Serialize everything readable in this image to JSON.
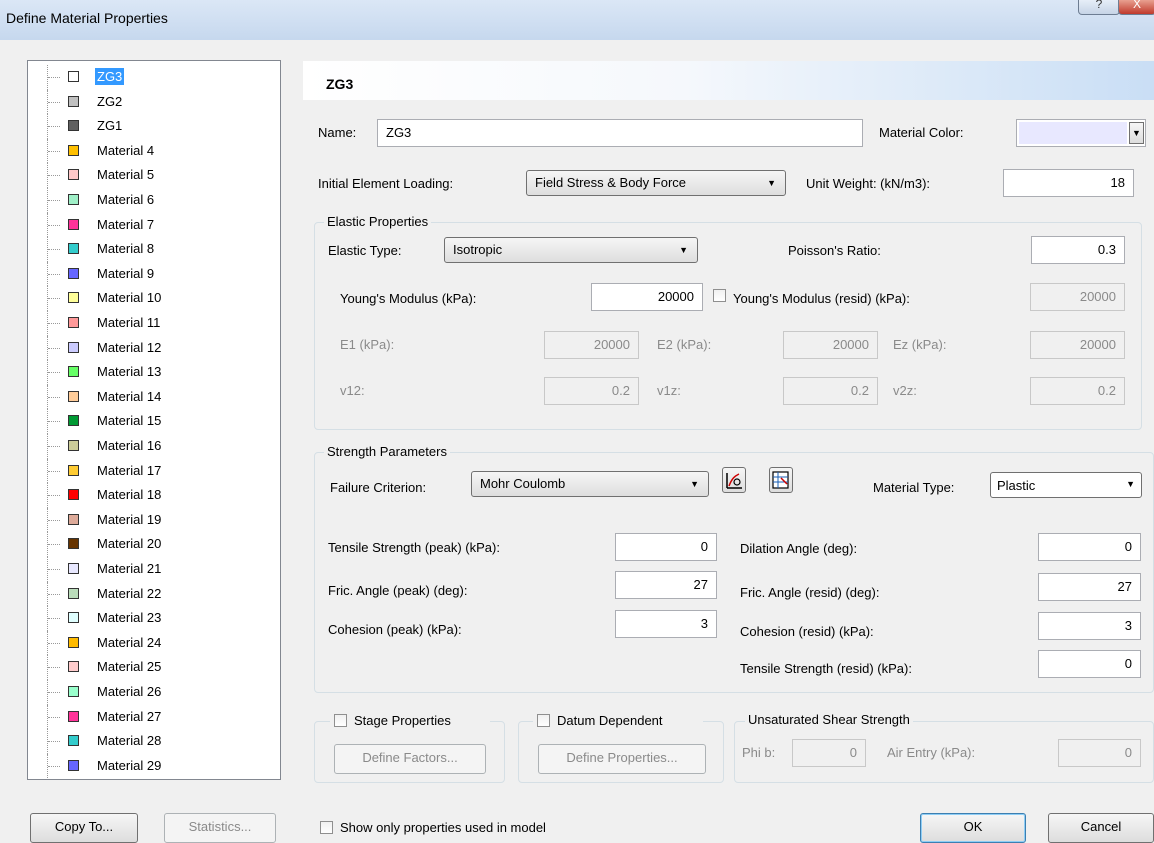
{
  "window": {
    "title": "Define Material Properties",
    "help_glyph": "?",
    "close_glyph": "X"
  },
  "tree": {
    "items": [
      {
        "label": "ZG3",
        "color": "#ffffff",
        "selected": true
      },
      {
        "label": "ZG2",
        "color": "#c0c0c0"
      },
      {
        "label": "ZG1",
        "color": "#606060"
      },
      {
        "label": "Material 4",
        "color": "#ffc000"
      },
      {
        "label": "Material 5",
        "color": "#ffc8c8"
      },
      {
        "label": "Material 6",
        "color": "#a0f0c8"
      },
      {
        "label": "Material 7",
        "color": "#ff3399"
      },
      {
        "label": "Material 8",
        "color": "#33cccc"
      },
      {
        "label": "Material 9",
        "color": "#6666ff"
      },
      {
        "label": "Material 10",
        "color": "#ffff99"
      },
      {
        "label": "Material 11",
        "color": "#ff9999"
      },
      {
        "label": "Material 12",
        "color": "#ccccff"
      },
      {
        "label": "Material 13",
        "color": "#66ff66"
      },
      {
        "label": "Material 14",
        "color": "#ffcc99"
      },
      {
        "label": "Material 15",
        "color": "#009933"
      },
      {
        "label": "Material 16",
        "color": "#cccc99"
      },
      {
        "label": "Material 17",
        "color": "#ffcc33"
      },
      {
        "label": "Material 18",
        "color": "#ff0000"
      },
      {
        "label": "Material 19",
        "color": "#ddaa99"
      },
      {
        "label": "Material 20",
        "color": "#663300"
      },
      {
        "label": "Material 21",
        "color": "#e8e8ff"
      },
      {
        "label": "Material 22",
        "color": "#bbddbb"
      },
      {
        "label": "Material 23",
        "color": "#e0ffff"
      },
      {
        "label": "Material 24",
        "color": "#ffbb00"
      },
      {
        "label": "Material 25",
        "color": "#ffcccc"
      },
      {
        "label": "Material 26",
        "color": "#99ffcc"
      },
      {
        "label": "Material 27",
        "color": "#ff3399"
      },
      {
        "label": "Material 28",
        "color": "#33cccc"
      },
      {
        "label": "Material 29",
        "color": "#6666ff"
      }
    ]
  },
  "header": {
    "title": "ZG3"
  },
  "general": {
    "name_label": "Name:",
    "name_value": "ZG3",
    "material_color_label": "Material Color:",
    "material_color": "#e8e8ff",
    "initial_loading_label": "Initial Element Loading:",
    "initial_loading_value": "Field Stress & Body Force",
    "unit_weight_label": "Unit Weight: (kN/m3):",
    "unit_weight_value": "18"
  },
  "elastic": {
    "group_label": "Elastic Properties",
    "type_label": "Elastic Type:",
    "type_value": "Isotropic",
    "poisson_label": "Poisson's Ratio:",
    "poisson_value": "0.3",
    "young_label": "Young's Modulus (kPa):",
    "young_value": "20000",
    "young_resid_label": "Young's Modulus (resid) (kPa):",
    "young_resid_value": "20000",
    "e1_label": "E1 (kPa):",
    "e1_value": "20000",
    "e2_label": "E2 (kPa):",
    "e2_value": "20000",
    "ez_label": "Ez (kPa):",
    "ez_value": "20000",
    "v12_label": "v12:",
    "v12_value": "0.2",
    "v1z_label": "v1z:",
    "v1z_value": "0.2",
    "v2z_label": "v2z:",
    "v2z_value": "0.2"
  },
  "strength": {
    "group_label": "Strength Parameters",
    "failure_label": "Failure Criterion:",
    "failure_value": "Mohr Coulomb",
    "material_type_label": "Material Type:",
    "material_type_value": "Plastic",
    "tensile_peak_label": "Tensile Strength (peak) (kPa):",
    "tensile_peak_value": "0",
    "fric_peak_label": "Fric. Angle (peak) (deg):",
    "fric_peak_value": "27",
    "cohesion_peak_label": "Cohesion (peak) (kPa):",
    "cohesion_peak_value": "3",
    "dilation_label": "Dilation Angle (deg):",
    "dilation_value": "0",
    "fric_resid_label": "Fric. Angle (resid) (deg):",
    "fric_resid_value": "27",
    "cohesion_resid_label": "Cohesion (resid) (kPa):",
    "cohesion_resid_value": "3",
    "tensile_resid_label": "Tensile Strength (resid) (kPa):",
    "tensile_resid_value": "0"
  },
  "stage": {
    "label": "Stage Properties",
    "button": "Define Factors..."
  },
  "datum": {
    "label": "Datum Dependent",
    "button": "Define Properties..."
  },
  "unsat": {
    "group_label": "Unsaturated Shear Strength",
    "phib_label": "Phi b:",
    "phib_value": "0",
    "air_label": "Air Entry (kPa):",
    "air_value": "0"
  },
  "footer": {
    "copy_to": "Copy To...",
    "statistics": "Statistics...",
    "show_only": "Show only properties used in model",
    "ok": "OK",
    "cancel": "Cancel"
  }
}
